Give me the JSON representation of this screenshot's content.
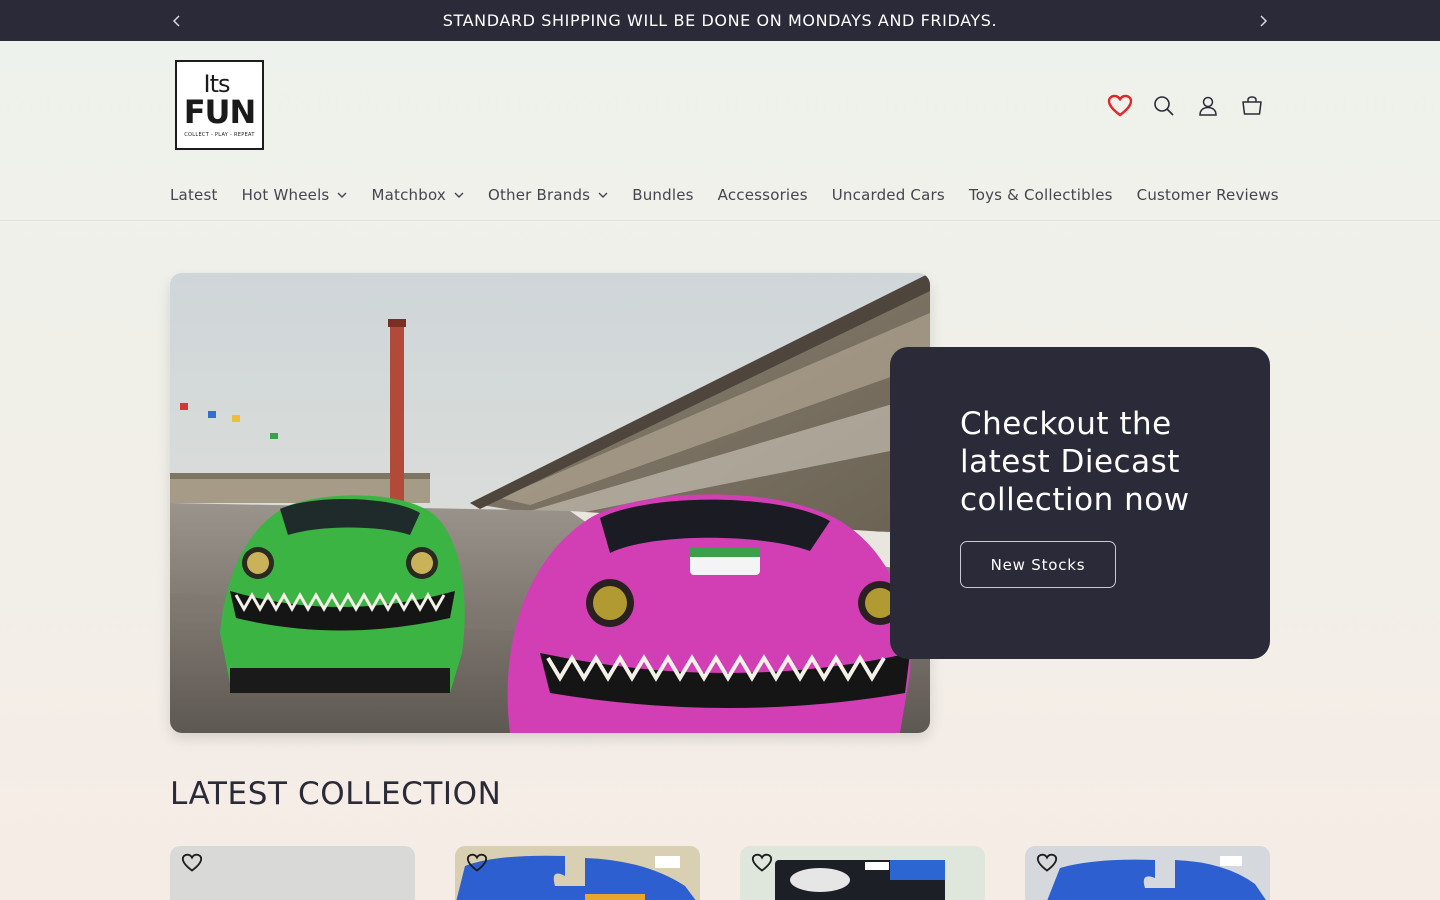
{
  "announcement": {
    "text": "STANDARD SHIPPING WILL BE DONE ON MONDAYS AND FRIDAYS."
  },
  "logo": {
    "line1": "Its",
    "line2": "FUN",
    "tagline": "COLLECT - PLAY - REPEAT"
  },
  "header_icons": [
    "heart-icon",
    "search-icon",
    "account-icon",
    "cart-icon"
  ],
  "nav": {
    "items": [
      {
        "label": "Latest",
        "dropdown": false
      },
      {
        "label": "Hot Wheels",
        "dropdown": true
      },
      {
        "label": "Matchbox",
        "dropdown": true
      },
      {
        "label": "Other Brands",
        "dropdown": true
      },
      {
        "label": "Bundles",
        "dropdown": false
      },
      {
        "label": "Accessories",
        "dropdown": false
      },
      {
        "label": "Uncarded Cars",
        "dropdown": false
      },
      {
        "label": "Toys & Collectibles",
        "dropdown": false
      },
      {
        "label": "Customer Reviews",
        "dropdown": false
      }
    ]
  },
  "hero": {
    "heading": "Checkout the latest Diecast collection now",
    "button_label": "New Stocks"
  },
  "section": {
    "title": "LATEST COLLECTION"
  },
  "colors": {
    "dark": "#2b2a38",
    "heart_accent": "#e0262b"
  }
}
